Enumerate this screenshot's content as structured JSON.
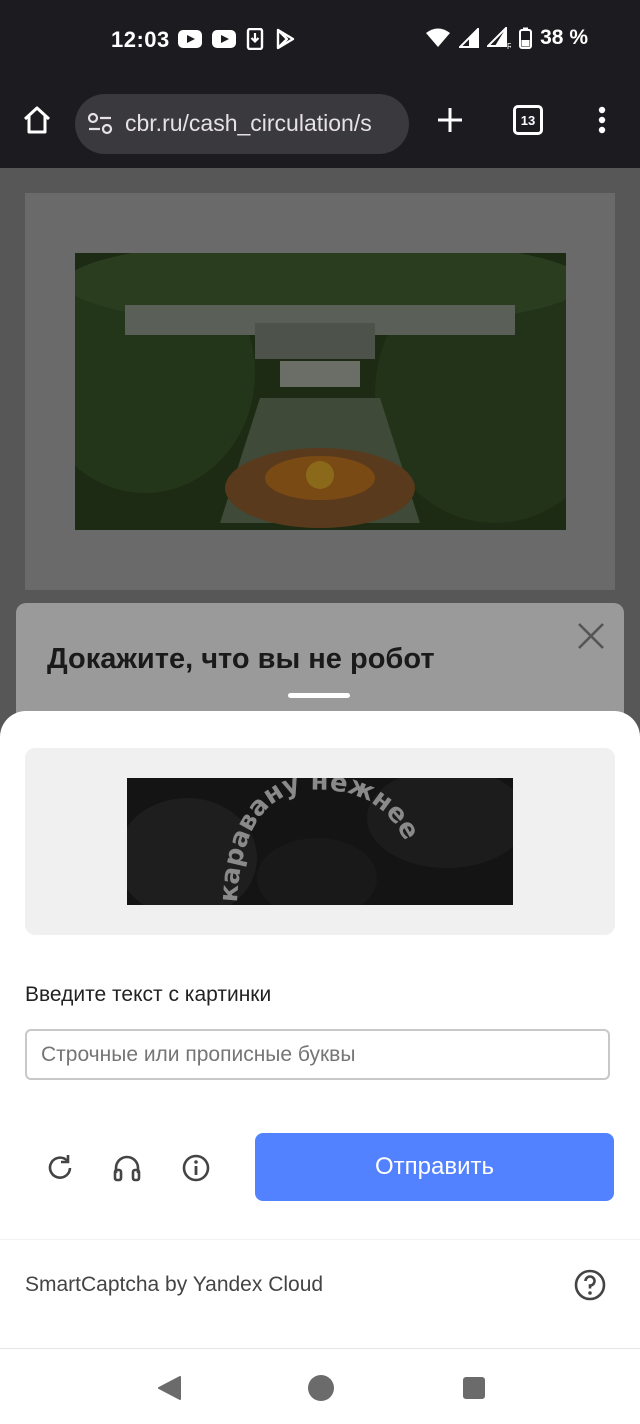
{
  "status_bar": {
    "time": "12:03",
    "battery_text": "38 %",
    "icons": [
      "youtube-icon",
      "youtube-icon",
      "download-icon",
      "play-store-icon",
      "wifi-icon",
      "signal-icon",
      "signal-roaming-icon",
      "battery-icon"
    ]
  },
  "browser": {
    "url": "cbr.ru/cash_circulation/s",
    "tab_count": "13",
    "icons": [
      "home-icon",
      "site-settings-icon",
      "new-tab-icon",
      "tab-switcher-icon",
      "more-menu-icon"
    ]
  },
  "dialog": {
    "title": "Докажите, что вы не робот",
    "close_icon": "close-icon"
  },
  "captcha": {
    "image_text": "каравану нежнее",
    "prompt_label": "Введите текст с картинки",
    "input_placeholder": "Строчные или прописные буквы",
    "input_value": "",
    "submit_label": "Отправить",
    "controls": [
      "refresh-icon",
      "audio-icon",
      "info-icon"
    ],
    "footer_text": "SmartCaptcha by Yandex Cloud",
    "help_icon": "help-icon"
  },
  "colors": {
    "submit_button": "#5282ff",
    "overlay_background": "#575757",
    "system_bar": "#1c1b1f"
  },
  "nav_bar": {
    "icons": [
      "back-icon",
      "home-nav-icon",
      "recents-icon"
    ]
  }
}
